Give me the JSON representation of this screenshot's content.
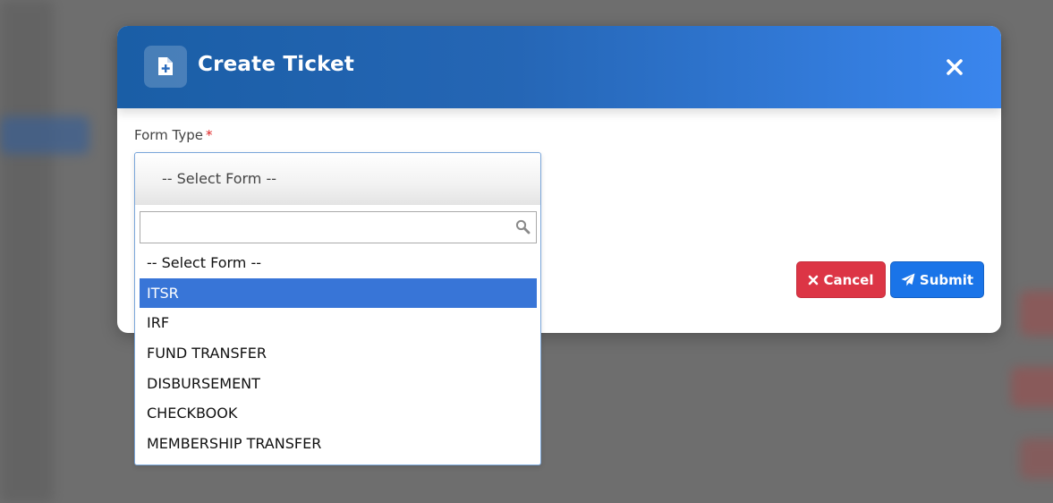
{
  "modal": {
    "title": "Create Ticket",
    "header_icon": "file-plus-icon",
    "close_icon": "close-icon"
  },
  "form": {
    "label": "Form Type",
    "required_mark": "*",
    "select": {
      "selected_text": "-- Select Form --",
      "search_value": "",
      "search_icon": "search-icon",
      "options": [
        "-- Select Form --",
        "ITSR",
        "IRF",
        "FUND TRANSFER",
        "DISBURSEMENT",
        "CHECKBOOK",
        "MEMBERSHIP TRANSFER"
      ],
      "highlighted": "ITSR"
    }
  },
  "buttons": {
    "cancel": {
      "label": "Cancel",
      "icon": "close-icon"
    },
    "submit": {
      "label": "Submit",
      "icon": "paper-plane-icon"
    }
  },
  "colors": {
    "header_start": "#1a5ea6",
    "header_end": "#3a86ee",
    "highlight": "#3875d7",
    "cancel": "#dc3545",
    "submit": "#1a74e8",
    "required": "#e02424"
  }
}
